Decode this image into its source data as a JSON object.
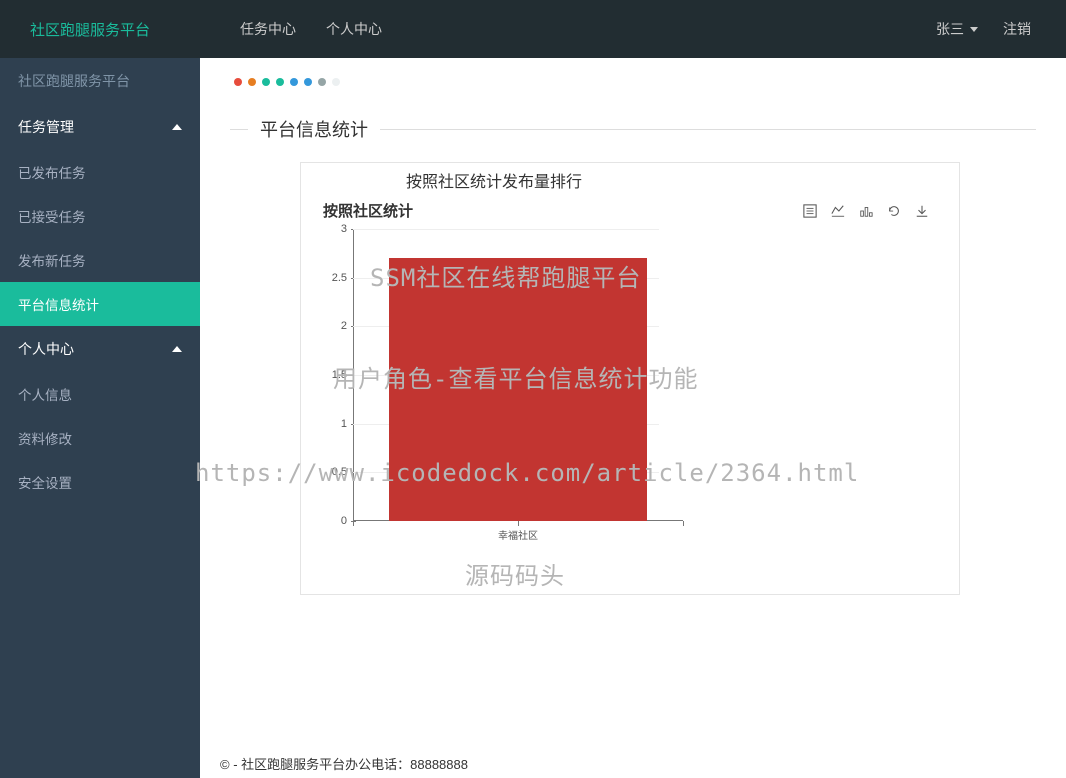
{
  "header": {
    "brand": "社区跑腿服务平台",
    "nav": [
      "任务中心",
      "个人中心"
    ],
    "user": "张三",
    "logout": "注销"
  },
  "sidebar": {
    "top_label": "社区跑腿服务平台",
    "group1": {
      "title": "任务管理",
      "items": [
        "已发布任务",
        "已接受任务",
        "发布新任务",
        "平台信息统计"
      ]
    },
    "group2": {
      "title": "个人中心",
      "items": [
        "个人信息",
        "资料修改",
        "安全设置"
      ]
    }
  },
  "page": {
    "title": "平台信息统计",
    "section_title": "按照社区统计发布量排行",
    "chart_title": "按照社区统计"
  },
  "dots": [
    "#e74c3c",
    "#e67e22",
    "#1abc9c",
    "#1abc9c",
    "#3498db",
    "#3498db",
    "#95a5a6",
    "#ecf0f1"
  ],
  "chart_data": {
    "type": "bar",
    "categories": [
      "幸福社区"
    ],
    "values": [
      2.7
    ],
    "title": "按照社区统计",
    "xlabel": "",
    "ylabel": "",
    "ylim": [
      0,
      3
    ],
    "y_ticks": [
      0,
      0.5,
      1,
      1.5,
      2,
      2.5,
      3
    ]
  },
  "footer": {
    "text": "© - 社区跑腿服务平台办公电话：88888888"
  },
  "watermarks": {
    "w1": "SSM社区在线帮跑腿平台",
    "w2": "用户角色-查看平台信息统计功能",
    "w3": "https://www.icodedock.com/article/2364.html",
    "w4": "源码码头"
  }
}
